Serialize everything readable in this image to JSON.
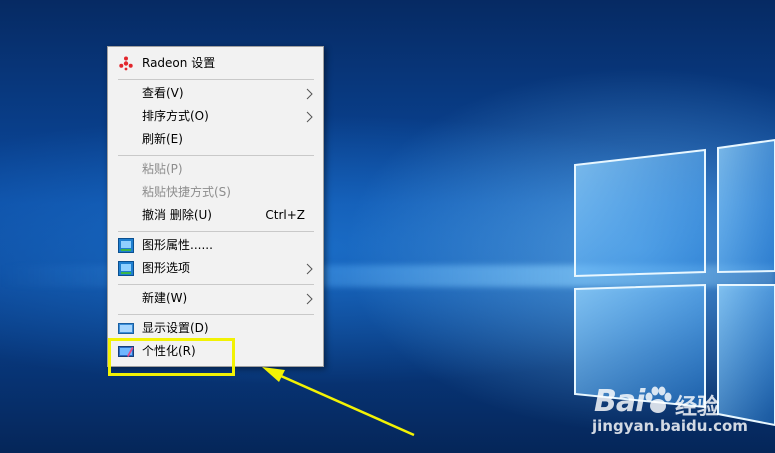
{
  "context_menu": {
    "items": [
      {
        "label": "Radeon 设置"
      },
      {
        "label": "查看(V)"
      },
      {
        "label": "排序方式(O)"
      },
      {
        "label": "刷新(E)"
      },
      {
        "label": "粘贴(P)"
      },
      {
        "label": "粘贴快捷方式(S)"
      },
      {
        "label": "撤消 删除(U)",
        "shortcut": "Ctrl+Z"
      },
      {
        "label": "图形属性......"
      },
      {
        "label": "图形选项"
      },
      {
        "label": "新建(W)"
      },
      {
        "label": "显示设置(D)"
      },
      {
        "label": "个性化(R)"
      }
    ]
  },
  "annotation": {
    "highlight_color": "#f2f204",
    "highlighted_item": "个性化(R)"
  },
  "watermark": {
    "brand": "Bai",
    "brand_cn": "经验",
    "url": "jingyan.baidu.com"
  },
  "colors": {
    "desktop_blue": "#0b4aa0",
    "menu_bg": "#f2f2f2",
    "disabled_text": "#8d8d8d",
    "radeon_red": "#e2262c"
  }
}
